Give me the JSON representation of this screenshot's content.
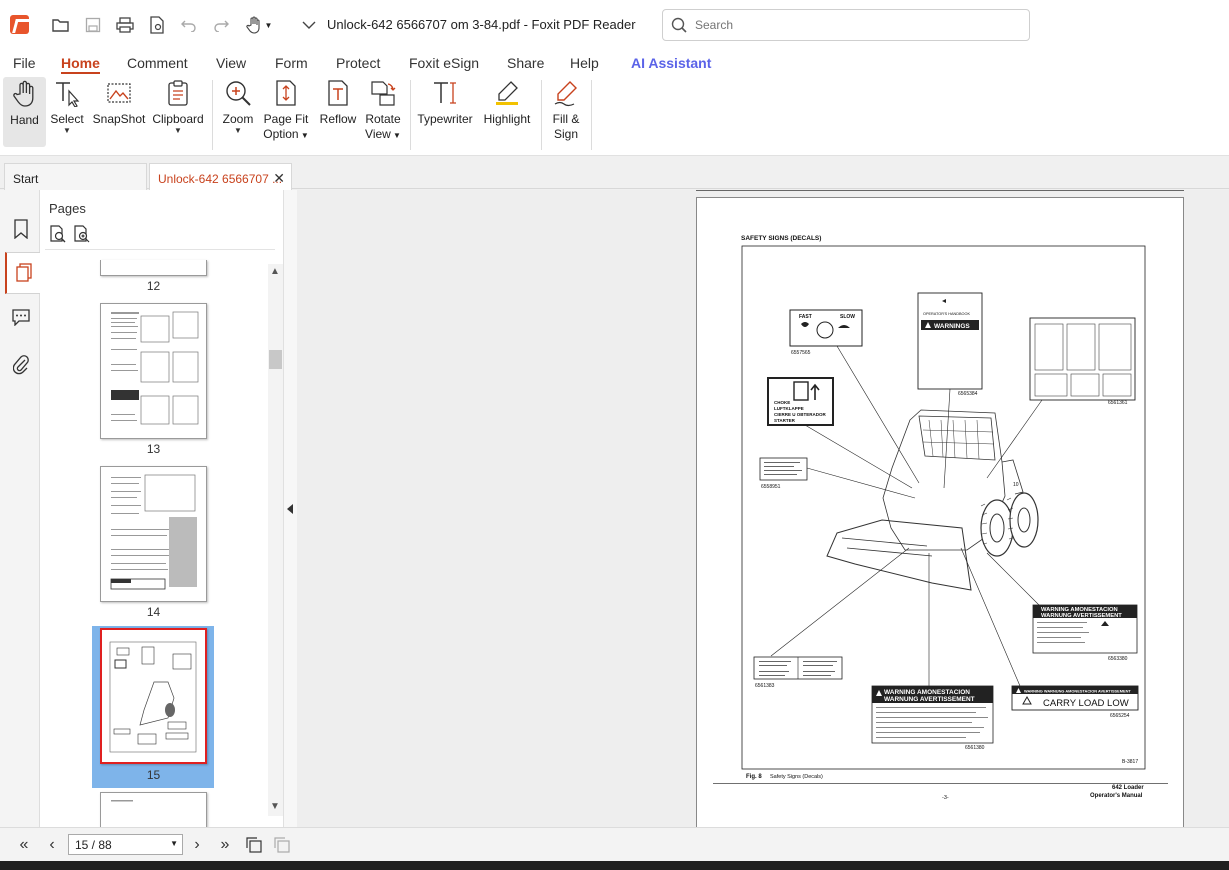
{
  "titlebar": {
    "document_title": "Unlock-642 6566707 om 3-84.pdf - Foxit PDF Reader",
    "search_placeholder": "Search"
  },
  "menu": {
    "file": "File",
    "home": "Home",
    "comment": "Comment",
    "view": "View",
    "form": "Form",
    "protect": "Protect",
    "esign": "Foxit eSign",
    "share": "Share",
    "help": "Help",
    "ai": "AI Assistant"
  },
  "ribbon": {
    "hand": "Hand",
    "select": "Select",
    "snapshot": "SnapShot",
    "clipboard": "Clipboard",
    "zoom": "Zoom",
    "page_fit_1": "Page Fit",
    "page_fit_2": "Option",
    "reflow": "Reflow",
    "rotate_1": "Rotate",
    "rotate_2": "View",
    "typewriter": "Typewriter",
    "highlight": "Highlight",
    "fill_sign_1": "Fill &",
    "fill_sign_2": "Sign"
  },
  "tabs": {
    "start": "Start",
    "document": "Unlock-642 6566707 ..."
  },
  "pages_panel": {
    "title": "Pages",
    "thumbnails": [
      {
        "number": "12"
      },
      {
        "number": "13"
      },
      {
        "number": "14"
      },
      {
        "number": "15"
      }
    ]
  },
  "document_page": {
    "heading": "SAFETY SIGNS (DECALS)",
    "decal_ids": {
      "d1": "6557565",
      "d2": "6565384",
      "d3": "6561361",
      "d4": "6558951",
      "d5": "6563380",
      "d6": "6561383",
      "d7": "6561380",
      "d8": "6565254"
    },
    "fast": "FAST",
    "slow": "SLOW",
    "operators_handbook": "OPERATOR'S HANDBOOK",
    "warnings": "WARNINGS",
    "choke_1": "CHOKE",
    "choke_2": "LUFTKLAPPE",
    "choke_3": "CIERRE U OBTERADOR",
    "choke_4": "STARTER",
    "warning_amon_1": "WARNING AMONESTACION",
    "warning_amon_2": "WARNUNG AVERTISSEMENT",
    "carry_warning": "WARNING   WARNUNG   AMONESTACION   AVERTISSEMENT",
    "carry_load_low": "CARRY LOAD LOW",
    "figure_ref": "B-3817",
    "caption_label": "Fig. 8",
    "caption_text": "Safety Signs (Decals)",
    "footer_model": "642 Loader",
    "footer_manual": "Operator's Manual",
    "page_number": "-3-"
  },
  "statusbar": {
    "page_indicator": "15 / 88"
  }
}
